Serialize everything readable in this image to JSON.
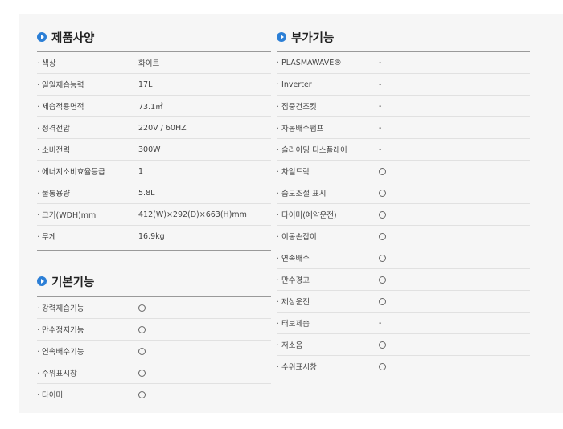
{
  "spec": {
    "title": "제품사양",
    "rows": [
      {
        "label": "색상",
        "value": "화이트"
      },
      {
        "label": "일일제습능력",
        "value": "17L"
      },
      {
        "label": "제습적용면적",
        "value": "73.1㎡"
      },
      {
        "label": "정격전압",
        "value": "220V / 60HZ"
      },
      {
        "label": "소비전력",
        "value": "300W"
      },
      {
        "label": "에너지소비효율등급",
        "value": "1"
      },
      {
        "label": "물통용량",
        "value": "5.8L"
      },
      {
        "label": "크기(WDH)mm",
        "value": "412(W)×292(D)×663(H)mm"
      },
      {
        "label": "무게",
        "value": "16.9kg"
      }
    ]
  },
  "basic": {
    "title": "기본기능",
    "rows": [
      {
        "label": "강력제습기능",
        "mark": "circle-icon"
      },
      {
        "label": "만수정지기능",
        "mark": "circle-icon"
      },
      {
        "label": "연속배수기능",
        "mark": "circle-icon"
      },
      {
        "label": "수위표시창",
        "mark": "circle-icon"
      },
      {
        "label": "타이머",
        "mark": "circle-icon"
      }
    ]
  },
  "extra": {
    "title": "부가기능",
    "rows": [
      {
        "label": "PLASMAWAVE®",
        "value": "-"
      },
      {
        "label": "Inverter",
        "value": "-"
      },
      {
        "label": "집중건조킷",
        "value": "-"
      },
      {
        "label": "자동배수펌프",
        "value": "-"
      },
      {
        "label": "슬라이딩 디스플레이",
        "value": "-"
      },
      {
        "label": "차일드락",
        "mark": "circle-icon"
      },
      {
        "label": "습도조절 표시",
        "mark": "circle-icon"
      },
      {
        "label": "타이머(예약운전)",
        "mark": "circle-icon"
      },
      {
        "label": "이동손잡이",
        "mark": "circle-icon"
      },
      {
        "label": "연속배수",
        "mark": "circle-icon"
      },
      {
        "label": "만수경고",
        "mark": "circle-icon"
      },
      {
        "label": "제상운전",
        "mark": "circle-icon"
      },
      {
        "label": "터보제습",
        "value": "-"
      },
      {
        "label": "저소음",
        "mark": "circle-icon"
      },
      {
        "label": "수위표시창",
        "mark": "circle-icon"
      }
    ]
  }
}
